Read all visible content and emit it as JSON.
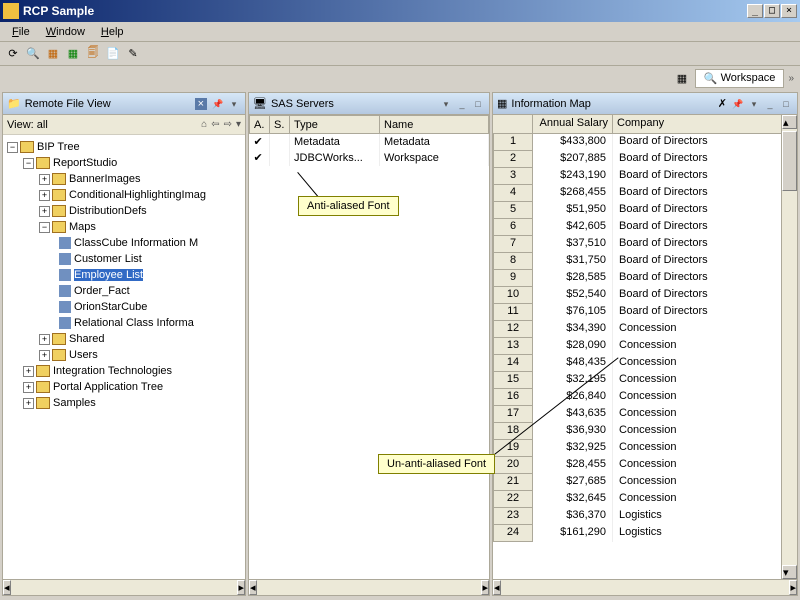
{
  "window": {
    "title": "RCP Sample"
  },
  "menu": {
    "file": "File",
    "window": "Window",
    "help": "Help"
  },
  "right_tabs": {
    "workspace": "Workspace"
  },
  "panels": {
    "left": {
      "title": "Remote File View",
      "view_label": "View: all"
    },
    "mid": {
      "title": "SAS Servers"
    },
    "right": {
      "title": "Information Map"
    }
  },
  "tree": {
    "root": "BIP Tree",
    "rs": "ReportStudio",
    "n1": "BannerImages",
    "n2": "ConditionalHighlightingImag",
    "n3": "DistributionDefs",
    "n4": "Maps",
    "m1": "ClassCube Information M",
    "m2": "Customer List",
    "m3": "Employee List",
    "m4": "Order_Fact",
    "m5": "OrionStarCube",
    "m6": "Relational Class Informa",
    "n5": "Shared",
    "n6": "Users",
    "t1": "Integration Technologies",
    "t2": "Portal Application Tree",
    "t3": "Samples"
  },
  "servers": {
    "cols": {
      "a": "A.",
      "s": "S.",
      "type": "Type",
      "name": "Name"
    },
    "rows": [
      {
        "type": "Metadata",
        "name": "Metadata"
      },
      {
        "type": "JDBCWorks...",
        "name": "Workspace"
      }
    ]
  },
  "infomap": {
    "cols": {
      "salary": "Annual Salary",
      "company": "Company"
    },
    "rows": [
      {
        "n": "1",
        "s": "$433,800",
        "c": "Board of Directors"
      },
      {
        "n": "2",
        "s": "$207,885",
        "c": "Board of Directors"
      },
      {
        "n": "3",
        "s": "$243,190",
        "c": "Board of Directors"
      },
      {
        "n": "4",
        "s": "$268,455",
        "c": "Board of Directors"
      },
      {
        "n": "5",
        "s": "$51,950",
        "c": "Board of Directors"
      },
      {
        "n": "6",
        "s": "$42,605",
        "c": "Board of Directors"
      },
      {
        "n": "7",
        "s": "$37,510",
        "c": "Board of Directors"
      },
      {
        "n": "8",
        "s": "$31,750",
        "c": "Board of Directors"
      },
      {
        "n": "9",
        "s": "$28,585",
        "c": "Board of Directors"
      },
      {
        "n": "10",
        "s": "$52,540",
        "c": "Board of Directors"
      },
      {
        "n": "11",
        "s": "$76,105",
        "c": "Board of Directors"
      },
      {
        "n": "12",
        "s": "$34,390",
        "c": "Concession"
      },
      {
        "n": "13",
        "s": "$28,090",
        "c": "Concession"
      },
      {
        "n": "14",
        "s": "$48,435",
        "c": "Concession"
      },
      {
        "n": "15",
        "s": "$32,195",
        "c": "Concession"
      },
      {
        "n": "16",
        "s": "$26,840",
        "c": "Concession"
      },
      {
        "n": "17",
        "s": "$43,635",
        "c": "Concession"
      },
      {
        "n": "18",
        "s": "$36,930",
        "c": "Concession"
      },
      {
        "n": "19",
        "s": "$32,925",
        "c": "Concession"
      },
      {
        "n": "20",
        "s": "$28,455",
        "c": "Concession"
      },
      {
        "n": "21",
        "s": "$27,685",
        "c": "Concession"
      },
      {
        "n": "22",
        "s": "$32,645",
        "c": "Concession"
      },
      {
        "n": "23",
        "s": "$36,370",
        "c": "Logistics"
      },
      {
        "n": "24",
        "s": "$161,290",
        "c": "Logistics"
      }
    ]
  },
  "callouts": {
    "aa": "Anti-aliased Font",
    "uaa": "Un-anti-aliased Font"
  }
}
